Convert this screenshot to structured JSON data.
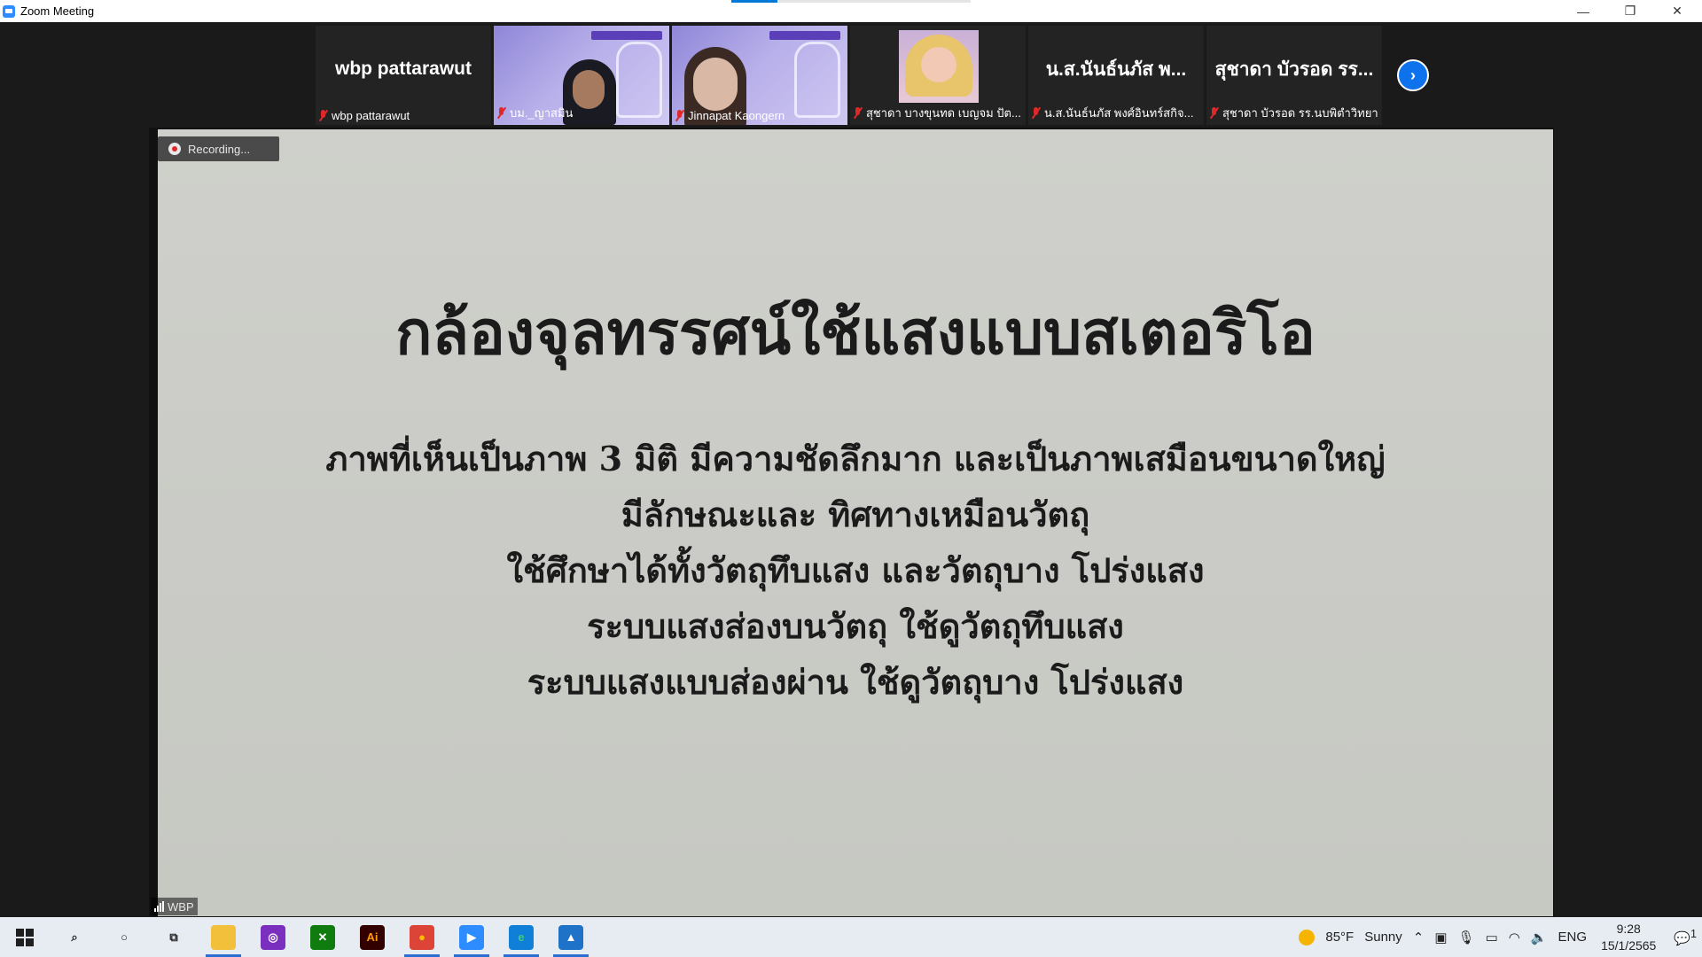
{
  "window": {
    "title": "Zoom Meeting",
    "controls": {
      "minimize": "—",
      "restore": "❐",
      "close": "✕"
    }
  },
  "participants": [
    {
      "display": "wbp pattarawut",
      "label": "wbp pattarawut",
      "type": "name"
    },
    {
      "display": "",
      "label": "บม._ญาสมิน",
      "type": "video1"
    },
    {
      "display": "",
      "label": "Jinnapat Kaongern",
      "type": "video2"
    },
    {
      "display": "",
      "label": "สุชาดา บางขุนทด เบญจม ปัต...",
      "type": "avatar"
    },
    {
      "display": "น.ส.นันธ์นภัส พ...",
      "label": "น.ส.นันธ์นภัส พงศ์อินทร์สกิจ...",
      "type": "name"
    },
    {
      "display": "สุชาดา บัวรอด รร...",
      "label": "สุชาดา บัวรอด รร.นบพิตำวิทยา",
      "type": "name"
    }
  ],
  "strip_next": "›",
  "recording": {
    "label": "Recording..."
  },
  "share_label": "WBP",
  "slide": {
    "title": "กล้องจุลทรรศน์ใช้แสงแบบสเตอริโอ",
    "lines": [
      "ภาพที่เห็นเป็นภาพ 3 มิติ มีความชัดลึกมาก และเป็นภาพเสมือนขนาดใหญ่",
      "มีลักษณะและ ทิศทางเหมือนวัตถุ",
      "ใช้ศึกษาได้ทั้งวัตถุทึบแสง และวัตถุบาง โปร่งแสง",
      "ระบบแสงส่องบนวัตถุ ใช้ดูวัตถุทึบแสง",
      "ระบบแสงแบบส่องผ่าน ใช้ดูวัตถุบาง โปร่งแสง"
    ]
  },
  "taskbar": {
    "start_icon": "windows-start-icon",
    "weather": {
      "temp": "85°F",
      "condition": "Sunny"
    },
    "language": "ENG",
    "time": "9:28",
    "date": "15/1/2565",
    "notification_count": "1",
    "apps": [
      {
        "name": "search-icon",
        "glyph": "⌕",
        "bg": "",
        "color": "#222",
        "active": false
      },
      {
        "name": "cortana-icon",
        "glyph": "○",
        "bg": "",
        "color": "#222",
        "active": false
      },
      {
        "name": "task-view-icon",
        "glyph": "⧉",
        "bg": "",
        "color": "#222",
        "active": false
      },
      {
        "name": "file-explorer-icon",
        "glyph": "▬",
        "bg": "#f3c03c",
        "color": "#f3c03c",
        "active": true
      },
      {
        "name": "podcast-app-icon",
        "glyph": "◎",
        "bg": "#7b2fbf",
        "color": "#fff",
        "active": false
      },
      {
        "name": "xbox-icon",
        "glyph": "✕",
        "bg": "#107c10",
        "color": "#fff",
        "active": false
      },
      {
        "name": "illustrator-icon",
        "glyph": "Ai",
        "bg": "#330000",
        "color": "#ff9a00",
        "active": false
      },
      {
        "name": "chrome-icon",
        "glyph": "●",
        "bg": "#db4437",
        "color": "#fbbc05",
        "active": true
      },
      {
        "name": "zoom-icon",
        "glyph": "▶",
        "bg": "#2d8cff",
        "color": "#fff",
        "active": true
      },
      {
        "name": "edge-icon",
        "glyph": "e",
        "bg": "#0f7fd7",
        "color": "#3ccb7f",
        "active": true
      },
      {
        "name": "photos-icon",
        "glyph": "▲",
        "bg": "#1e73c8",
        "color": "#fff",
        "active": true
      }
    ]
  }
}
